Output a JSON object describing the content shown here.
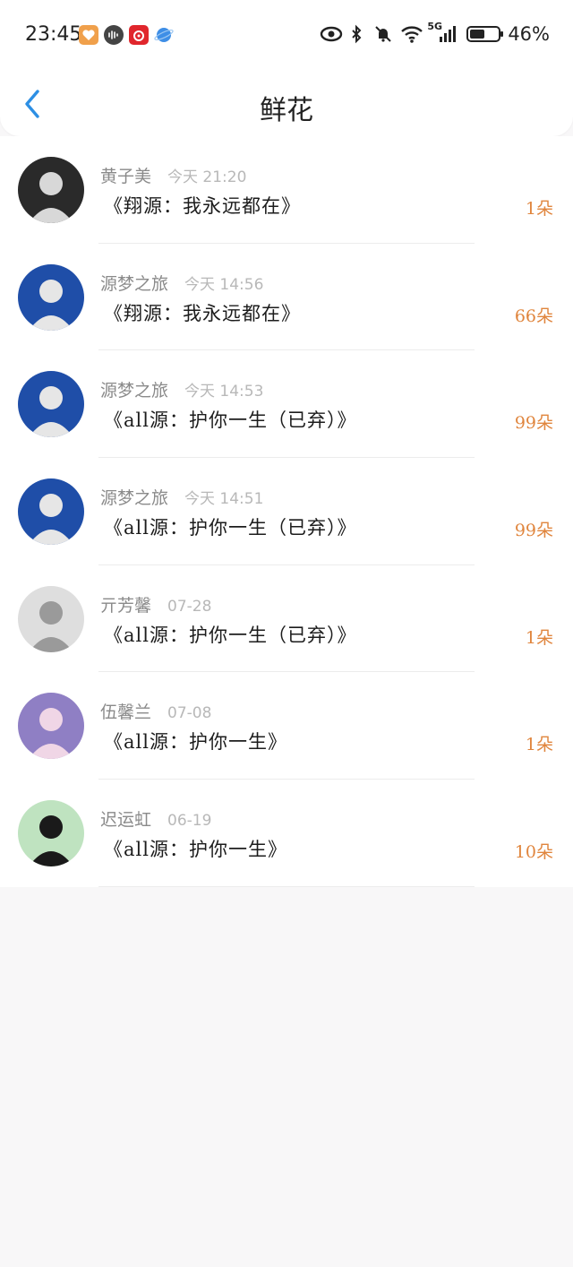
{
  "status_bar": {
    "time": "23:45",
    "network": "5G",
    "battery_percent": "46%",
    "battery_level": 0.46,
    "app_icons": [
      {
        "name": "heart-app-icon",
        "color": "#f0a04b"
      },
      {
        "name": "soundwave-app-icon",
        "color": "#444444"
      },
      {
        "name": "netease-music-app-icon",
        "color": "#e0262c"
      },
      {
        "name": "browser-planet-app-icon",
        "color": "#3e8ee6"
      }
    ],
    "system_icons": [
      "eye-icon",
      "bluetooth-icon",
      "mute-bell-icon",
      "wifi-icon",
      "signal-icon"
    ]
  },
  "header": {
    "title": "鲜花",
    "back_icon": "chevron-left-icon",
    "accent_color": "#2d8fe4"
  },
  "list": {
    "count_color": "#e0853d",
    "items": [
      {
        "sender": "黄子美",
        "time": "今天 21:20",
        "title": "《翔源：我永远都在》",
        "count": "1朵",
        "avatar": {
          "bg": "#2a2a2a",
          "fg": "#d8d8d8"
        }
      },
      {
        "sender": "源梦之旅",
        "time": "今天 14:56",
        "title": "《翔源：我永远都在》",
        "count": "66朵",
        "avatar": {
          "bg": "#1f4ea8",
          "fg": "#e6e6e6"
        }
      },
      {
        "sender": "源梦之旅",
        "time": "今天 14:53",
        "title": "《all源：护你一生（已弃）》",
        "count": "99朵",
        "avatar": {
          "bg": "#1f4ea8",
          "fg": "#e6e6e6"
        }
      },
      {
        "sender": "源梦之旅",
        "time": "今天 14:51",
        "title": "《all源：护你一生（已弃）》",
        "count": "99朵",
        "avatar": {
          "bg": "#1f4ea8",
          "fg": "#e6e6e6"
        }
      },
      {
        "sender": "亓芳馨",
        "time": "07-28",
        "title": "《all源：护你一生（已弃）》",
        "count": "1朵",
        "avatar": {
          "bg": "#dedede",
          "fg": "#9a9a9a"
        }
      },
      {
        "sender": "伍馨兰",
        "time": "07-08",
        "title": "《all源：护你一生》",
        "count": "1朵",
        "avatar": {
          "bg": "#8f7fc4",
          "fg": "#f0d6e6"
        }
      },
      {
        "sender": "迟运虹",
        "time": "06-19",
        "title": "《all源：护你一生》",
        "count": "10朵",
        "avatar": {
          "bg": "#bfe3c0",
          "fg": "#1a1a1a"
        }
      }
    ]
  }
}
